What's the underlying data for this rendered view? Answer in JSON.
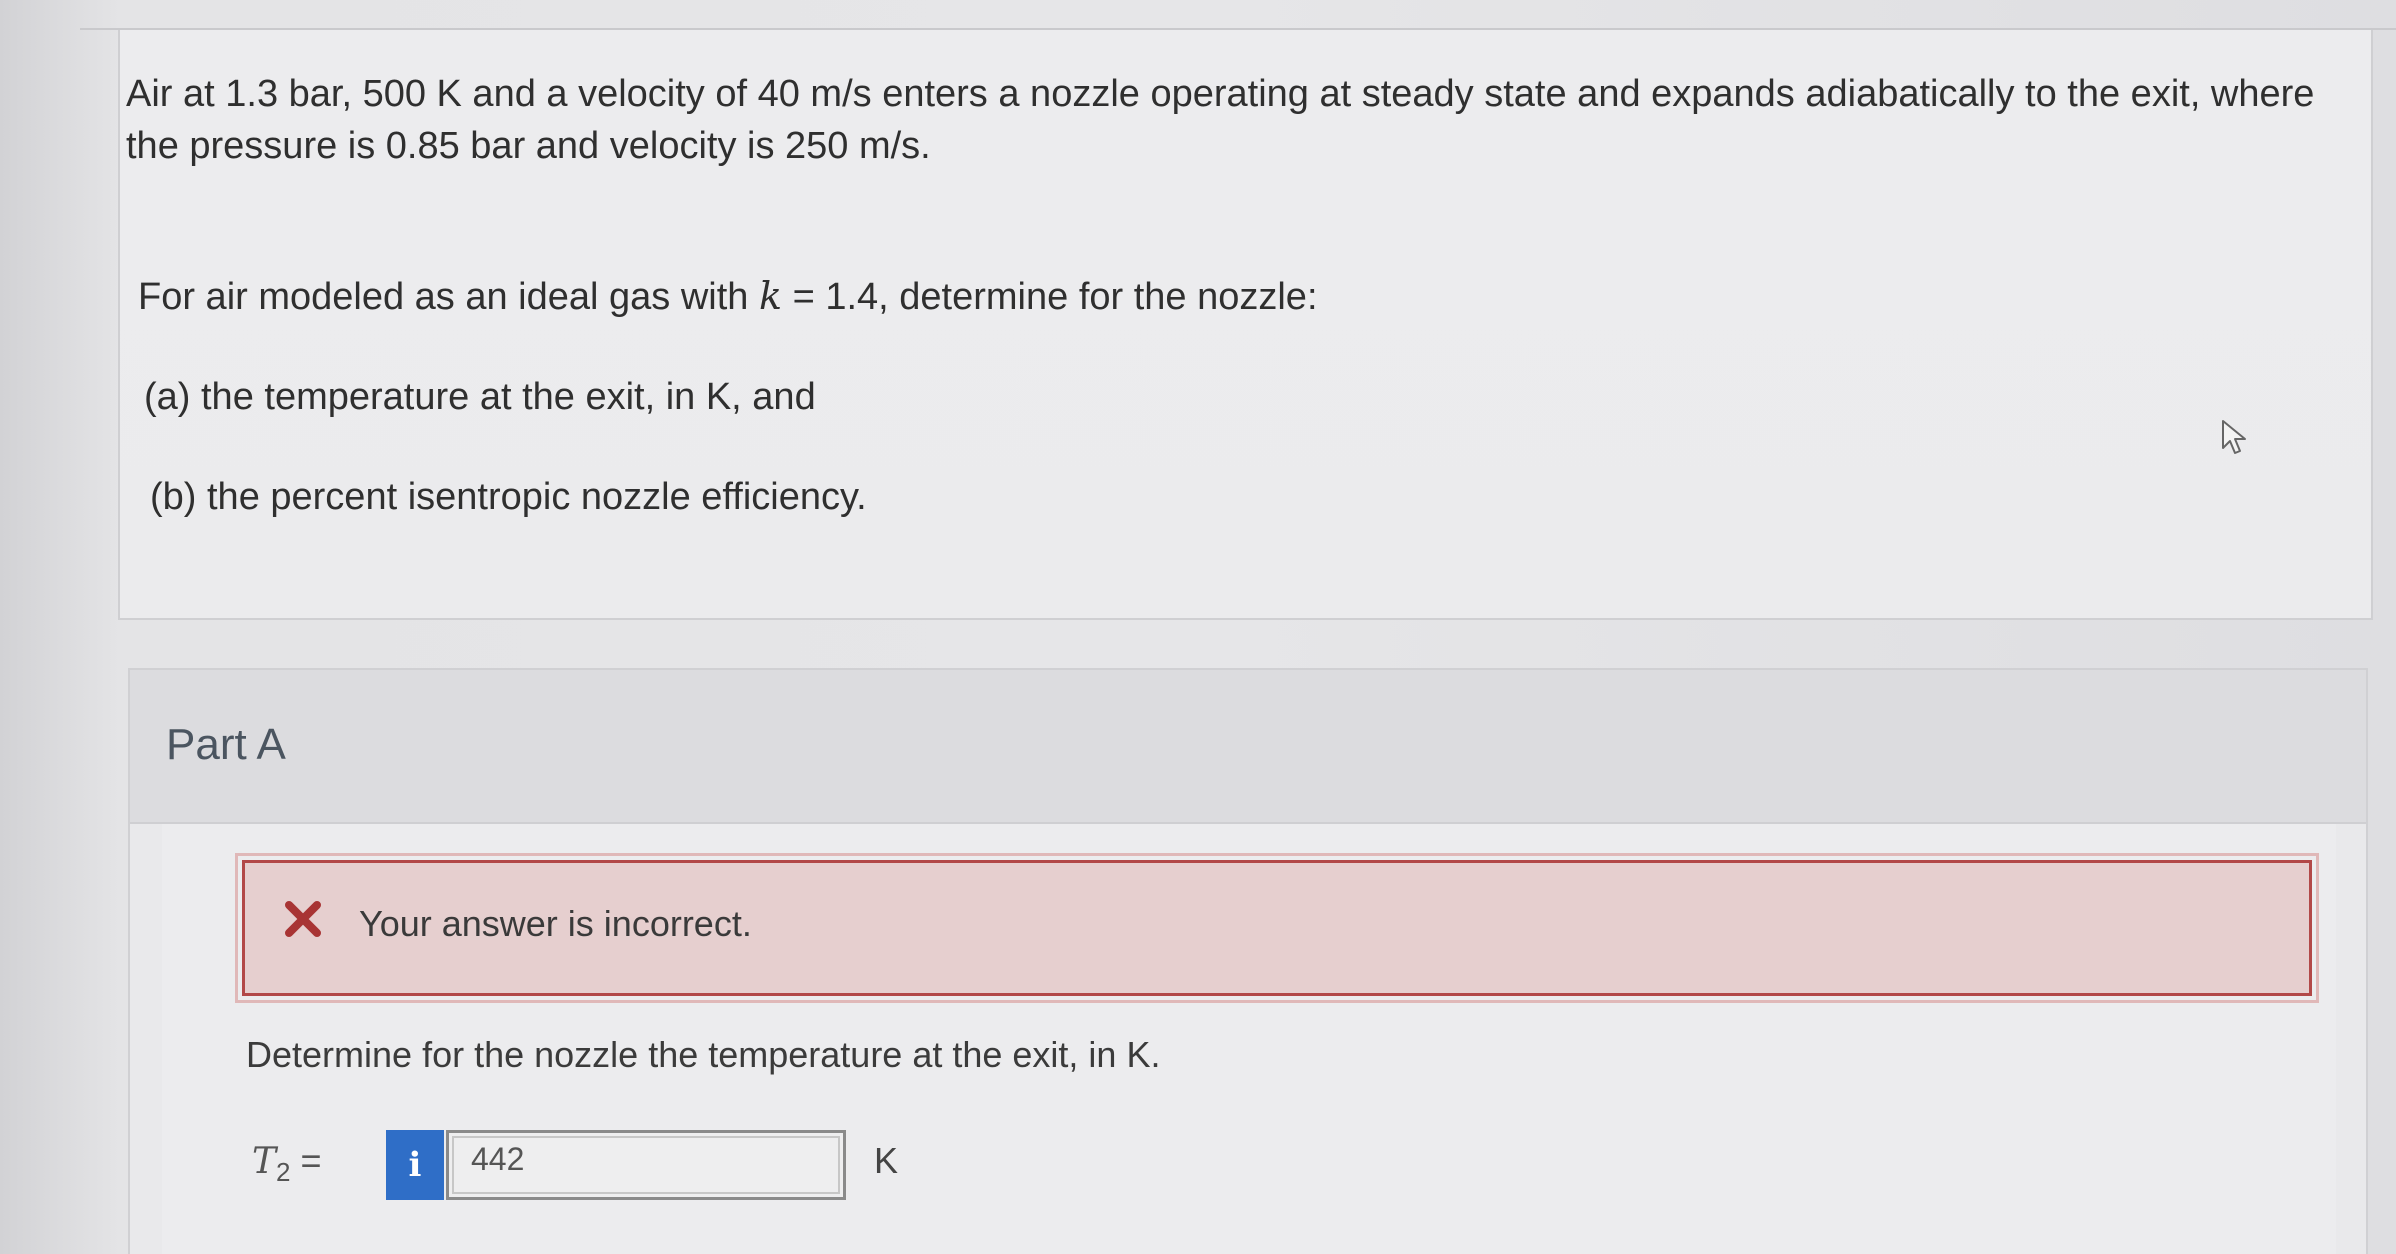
{
  "problem": {
    "statement": "Air at 1.3 bar, 500 K and a velocity of 40 m/s enters a nozzle operating at steady state and expands adiabatically to the exit, where the pressure is 0.85 bar and velocity is 250 m/s.",
    "intro_prefix": "For air modeled as an ideal gas with ",
    "intro_var": "k",
    "intro_suffix": " = 1.4, determine for the nozzle:",
    "part_a": "(a) the temperature at the exit, in K, and",
    "part_b": "(b) the percent isentropic nozzle efficiency."
  },
  "part_a": {
    "title": "Part A",
    "feedback": "Your answer is incorrect.",
    "prompt": "Determine for the nozzle the temperature at the exit, in K.",
    "variable": "T",
    "variable_sub": "2",
    "equals": "=",
    "info_label": "i",
    "answer_value": "442",
    "unit": "K"
  },
  "colors": {
    "error_border": "#b24848",
    "error_bg": "#e6cfcf",
    "info_button": "#2f6ec7"
  },
  "icons": [
    "x-mark-icon",
    "info-icon",
    "mouse-cursor-icon"
  ]
}
